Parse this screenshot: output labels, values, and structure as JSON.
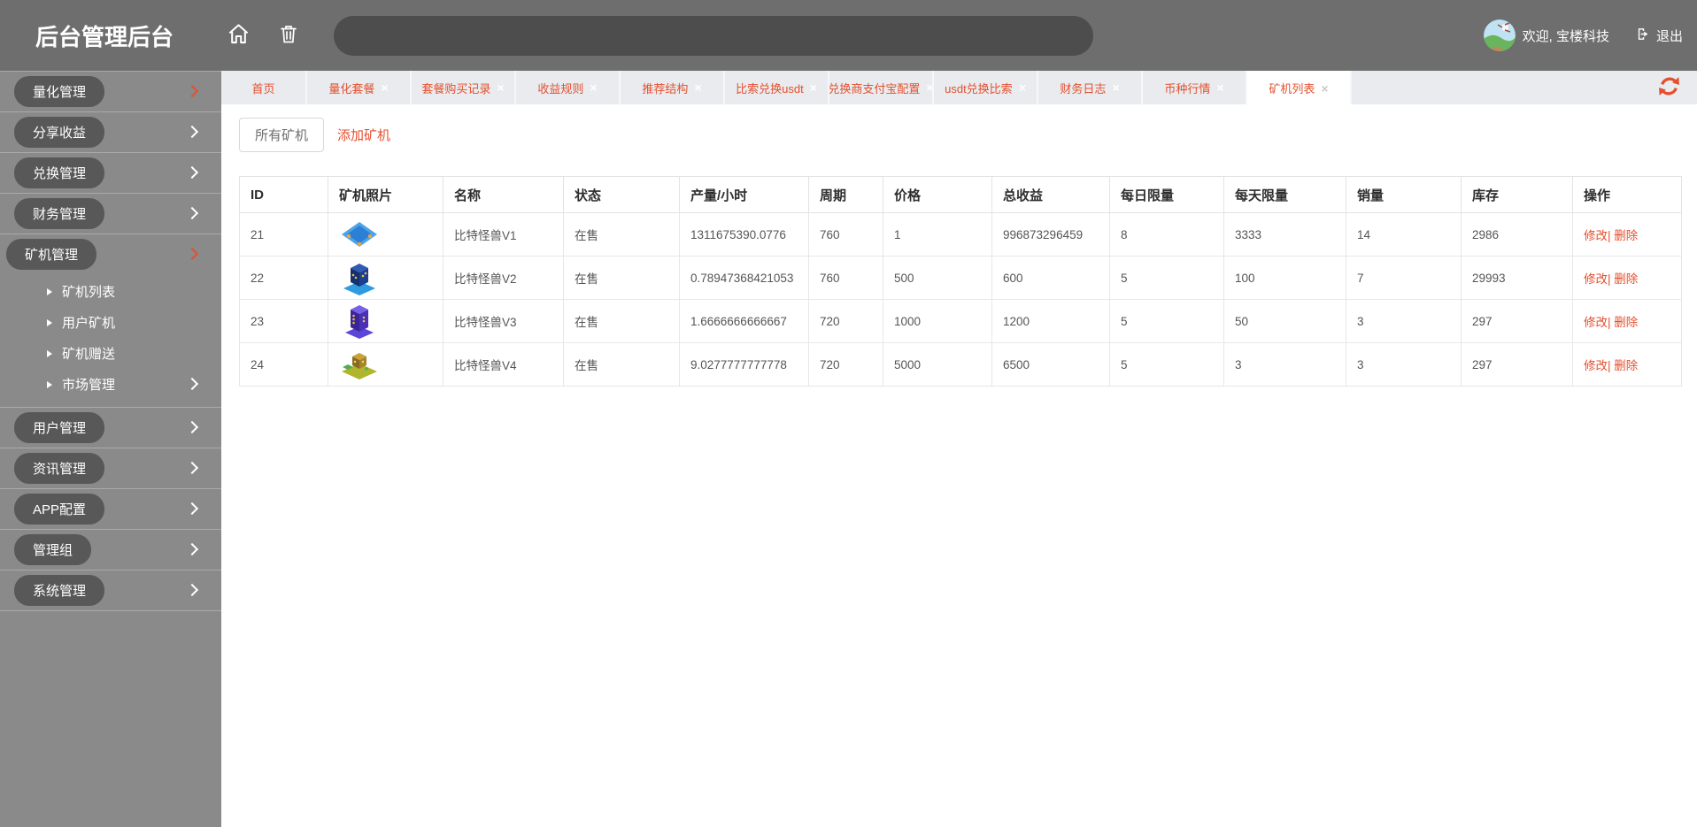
{
  "colors": {
    "accent": "#e4502f",
    "header_bg": "#6e6e6e",
    "sidebar_bg": "#8a8a8a",
    "sidebar_pill_bg": "#585858",
    "tabbar_bg": "#e9ebee",
    "active_tab_bg": "#ffffff",
    "table_border": "#e7e7e7"
  },
  "icons": {
    "tab_close_glyph": "×",
    "names": [
      "home-icon",
      "trash-icon",
      "avatar",
      "logout-icon",
      "refresh-icon",
      "chevron-right-icon",
      "caret-right-icon",
      "close-icon"
    ]
  },
  "header": {
    "title": "后台管理后台",
    "search_value": "",
    "welcome": "欢迎, 宝楼科技",
    "logout": "退出"
  },
  "tabbar": {
    "tabs": [
      {
        "label": "首页",
        "closable": false,
        "active": false
      },
      {
        "label": "量化套餐",
        "closable": true,
        "active": false
      },
      {
        "label": "套餐购买记录",
        "closable": true,
        "active": false
      },
      {
        "label": "收益规则",
        "closable": true,
        "active": false
      },
      {
        "label": "推荐结构",
        "closable": true,
        "active": false
      },
      {
        "label": "比索兑换usdt",
        "closable": true,
        "active": false
      },
      {
        "label": "兑换商支付宝配置",
        "closable": true,
        "active": false
      },
      {
        "label": "usdt兑换比索",
        "closable": true,
        "active": false
      },
      {
        "label": "财务日志",
        "closable": true,
        "active": false
      },
      {
        "label": "币种行情",
        "closable": true,
        "active": false
      },
      {
        "label": "矿机列表",
        "closable": true,
        "active": true
      }
    ]
  },
  "sidebar": {
    "items": [
      {
        "label": "量化管理",
        "highlight": true,
        "current": false,
        "children": []
      },
      {
        "label": "分享收益",
        "highlight": false,
        "current": false,
        "children": []
      },
      {
        "label": "兑换管理",
        "highlight": false,
        "current": false,
        "children": []
      },
      {
        "label": "财务管理",
        "highlight": false,
        "current": false,
        "children": []
      },
      {
        "label": "矿机管理",
        "highlight": true,
        "current": true,
        "children": [
          {
            "label": "矿机列表",
            "chevron": false
          },
          {
            "label": "用户矿机",
            "chevron": false
          },
          {
            "label": "矿机赠送",
            "chevron": false
          },
          {
            "label": "市场管理",
            "chevron": true
          }
        ]
      },
      {
        "label": "用户管理",
        "highlight": false,
        "current": false,
        "children": []
      },
      {
        "label": "资讯管理",
        "highlight": false,
        "current": false,
        "children": []
      },
      {
        "label": "APP配置",
        "highlight": false,
        "current": false,
        "children": []
      },
      {
        "label": "管理组",
        "highlight": false,
        "current": false,
        "children": []
      },
      {
        "label": "系统管理",
        "highlight": false,
        "current": false,
        "children": []
      }
    ]
  },
  "content": {
    "subtabs": [
      {
        "label": "所有矿机",
        "active": true
      },
      {
        "label": "添加矿机",
        "active": false
      }
    ],
    "table": {
      "columns": [
        "ID",
        "矿机照片",
        "名称",
        "状态",
        "产量/小时",
        "周期",
        "价格",
        "总收益",
        "每日限量",
        "每天限量",
        "销量",
        "库存",
        "操作"
      ],
      "actions": {
        "edit": "修改",
        "separator": "|",
        "delete": "删除"
      },
      "rows": [
        {
          "id": "21",
          "name": "比特怪兽V1",
          "status": "在售",
          "output_per_hour": "1311675390.0776",
          "cycle": "760",
          "price": "1",
          "total_income": "996873296459",
          "daily_limit": "8",
          "day_limit": "3333",
          "sales": "14",
          "stock": "2986",
          "photo": {
            "style": "flat",
            "outer": "#4ea3e8",
            "inner": "#2b7fd4",
            "dots": "#f2a33c"
          }
        },
        {
          "id": "22",
          "name": "比特怪兽V2",
          "status": "在售",
          "output_per_hour": "0.78947368421053",
          "cycle": "760",
          "price": "500",
          "total_income": "600",
          "daily_limit": "5",
          "day_limit": "100",
          "sales": "7",
          "stock": "29993",
          "photo": {
            "style": "box",
            "base": "#2e9ae0",
            "top": "#2f5bb5",
            "left": "#16306e",
            "right": "#1d3f8f",
            "dots": "#f0c040"
          }
        },
        {
          "id": "23",
          "name": "比特怪兽V3",
          "status": "在售",
          "output_per_hour": "1.6666666666667",
          "cycle": "720",
          "price": "1000",
          "total_income": "1200",
          "daily_limit": "5",
          "day_limit": "50",
          "sales": "3",
          "stock": "297",
          "photo": {
            "style": "tall",
            "base": "#5a46d8",
            "top": "#7a5fe8",
            "left": "#3a2597",
            "right": "#4a31b8",
            "dots": "#e8b84a"
          }
        },
        {
          "id": "24",
          "name": "比特怪兽V4",
          "status": "在售",
          "output_per_hour": "9.0277777777778",
          "cycle": "720",
          "price": "5000",
          "total_income": "6500",
          "daily_limit": "5",
          "day_limit": "3",
          "sales": "3",
          "stock": "297",
          "photo": {
            "style": "farm",
            "base": "#b0b52c",
            "top": "#c9a23a",
            "left": "#8a6a22",
            "right": "#a5842c",
            "dots": "#f0e050",
            "accent": "#4fae4f"
          }
        }
      ]
    }
  }
}
